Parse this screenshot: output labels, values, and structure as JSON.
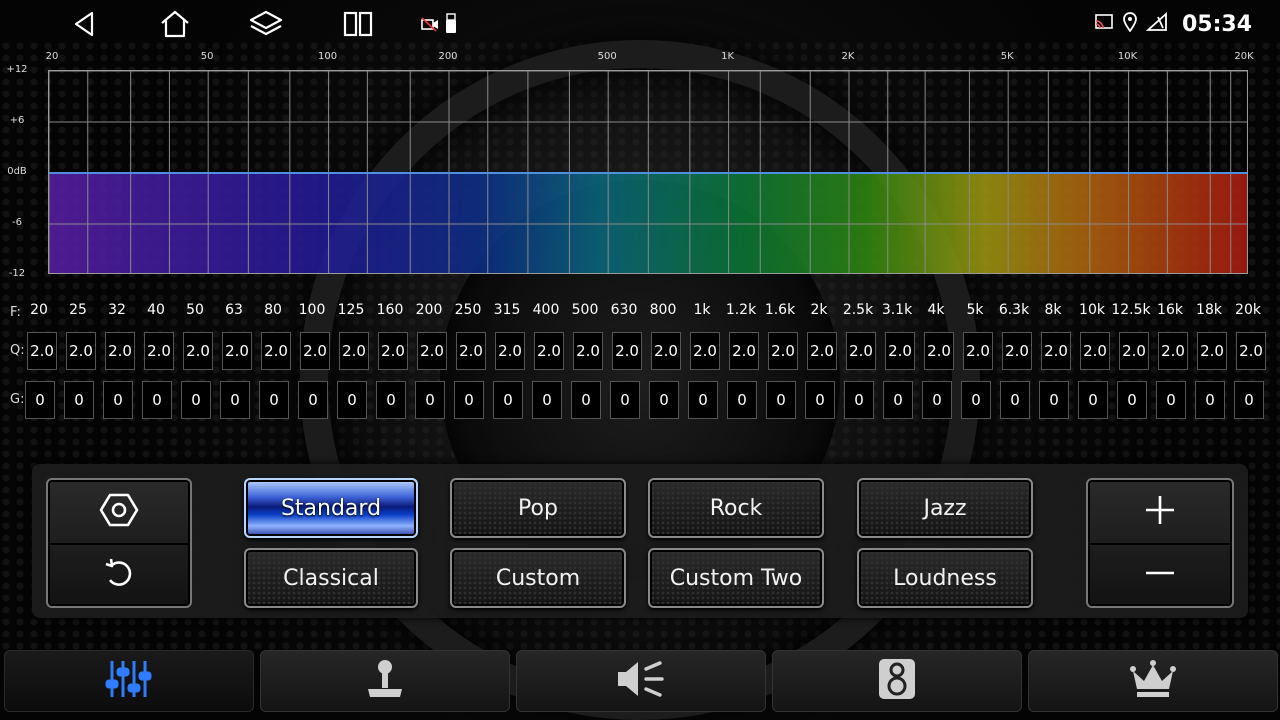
{
  "status": {
    "time": "05:34",
    "icons": [
      "cast-icon",
      "location-icon",
      "signal-icon"
    ],
    "notification_icons": [
      "camera-off-icon",
      "usb-icon"
    ]
  },
  "nav": [
    "back-icon",
    "home-icon",
    "layers-icon",
    "split-screen-icon"
  ],
  "graph": {
    "x_axis_labels": [
      "20",
      "50",
      "100",
      "200",
      "500",
      "1K",
      "2K",
      "5K",
      "10K",
      "20K"
    ],
    "y_axis_labels": [
      "+12",
      "+6",
      "0dB",
      "-6",
      "-12"
    ],
    "curve_gain_db": 0,
    "curve_color": "#4f8fe0"
  },
  "bands": {
    "f_label": "F:",
    "q_label": "Q:",
    "g_label": "G:",
    "frequencies": [
      "20",
      "25",
      "32",
      "40",
      "50",
      "63",
      "80",
      "100",
      "125",
      "160",
      "200",
      "250",
      "315",
      "400",
      "500",
      "630",
      "800",
      "1k",
      "1.2k",
      "1.6k",
      "2k",
      "2.5k",
      "3.1k",
      "4k",
      "5k",
      "6.3k",
      "8k",
      "10k",
      "12.5k",
      "16k",
      "18k",
      "20k"
    ],
    "q": [
      "2.0",
      "2.0",
      "2.0",
      "2.0",
      "2.0",
      "2.0",
      "2.0",
      "2.0",
      "2.0",
      "2.0",
      "2.0",
      "2.0",
      "2.0",
      "2.0",
      "2.0",
      "2.0",
      "2.0",
      "2.0",
      "2.0",
      "2.0",
      "2.0",
      "2.0",
      "2.0",
      "2.0",
      "2.0",
      "2.0",
      "2.0",
      "2.0",
      "2.0",
      "2.0",
      "2.0",
      "2.0"
    ],
    "gain": [
      "0",
      "0",
      "0",
      "0",
      "0",
      "0",
      "0",
      "0",
      "0",
      "0",
      "0",
      "0",
      "0",
      "0",
      "0",
      "0",
      "0",
      "0",
      "0",
      "0",
      "0",
      "0",
      "0",
      "0",
      "0",
      "0",
      "0",
      "0",
      "0",
      "0",
      "0",
      "0"
    ]
  },
  "presets": {
    "active": "Standard",
    "row1": [
      "Standard",
      "Pop",
      "Rock",
      "Jazz"
    ],
    "row2": [
      "Classical",
      "Custom",
      "Custom Two",
      "Loudness"
    ]
  },
  "controls": {
    "left": [
      "settings-hex-icon",
      "reset-icon"
    ],
    "right": [
      "plus-icon",
      "minus-icon"
    ]
  },
  "tabs": [
    {
      "icon": "equalizer-icon",
      "active": true
    },
    {
      "icon": "joystick-balance-icon",
      "active": false
    },
    {
      "icon": "speaker-sound-icon",
      "active": false
    },
    {
      "icon": "subwoofer-icon",
      "active": false
    },
    {
      "icon": "crown-icon",
      "active": false
    }
  ],
  "colors": {
    "accent": "#2f7cff",
    "active_tab_icon": "#2f7cff",
    "tab_icon": "#cfcfcf"
  }
}
